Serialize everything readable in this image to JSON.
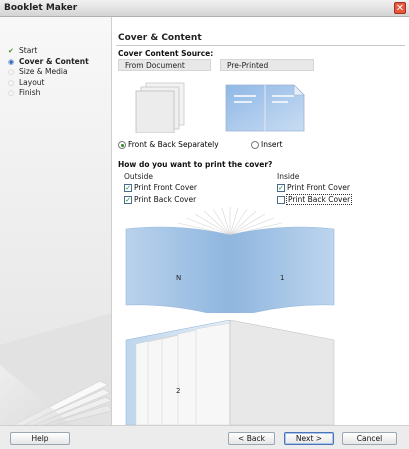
{
  "window": {
    "title": "Booklet Maker"
  },
  "sidebar": {
    "steps": [
      {
        "label": "Start",
        "state": "done",
        "icon": "checkmark-icon"
      },
      {
        "label": "Cover & Content",
        "state": "current",
        "icon": "current-step-icon"
      },
      {
        "label": "Size & Media",
        "state": "pending",
        "icon": "pending-step-icon"
      },
      {
        "label": "Layout",
        "state": "pending",
        "icon": "pending-step-icon"
      },
      {
        "label": "Finish",
        "state": "pending",
        "icon": "pending-step-icon"
      }
    ]
  },
  "main": {
    "heading": "Cover & Content",
    "cover_source": {
      "label": "Cover Content Source:",
      "options": [
        "From Document",
        "Pre-Printed"
      ]
    },
    "radios": [
      {
        "label": "Front & Back Separately",
        "checked": true
      },
      {
        "label": "Insert",
        "checked": false
      }
    ],
    "print_question": "How do you want to print the cover?",
    "outside": {
      "label": "Outside",
      "checkboxes": [
        {
          "label": "Print Front Cover",
          "checked": true
        },
        {
          "label": "Print Back Cover",
          "checked": true
        }
      ]
    },
    "inside": {
      "label": "Inside",
      "checkboxes": [
        {
          "label": "Print Front Cover",
          "checked": true
        },
        {
          "label": "Print Back Cover",
          "checked": false
        }
      ]
    },
    "preview": {
      "top_book": {
        "left_page": "N",
        "right_page": "1"
      },
      "bottom_book": {
        "left_page": "2"
      }
    }
  },
  "buttons": {
    "help": "Help",
    "back": "< Back",
    "next": "Next >",
    "cancel": "Cancel"
  },
  "colors": {
    "accent": "#2a63b8",
    "cover_blue": "#a8c8e8",
    "check_green": "#1f8a1f",
    "close_red": "#e8573b"
  }
}
